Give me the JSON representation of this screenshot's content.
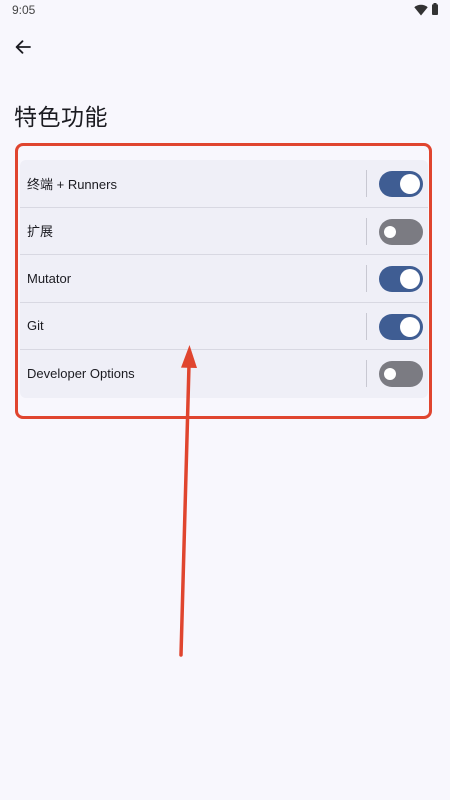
{
  "status_bar": {
    "time": "9:05",
    "icons": [
      "wifi-icon",
      "battery-icon"
    ]
  },
  "header": {
    "back_icon": "arrow-left-icon",
    "title": "特色功能"
  },
  "settings": {
    "items": [
      {
        "label": "终端 + Runners",
        "enabled": true
      },
      {
        "label": "扩展",
        "enabled": false
      },
      {
        "label": "Mutator",
        "enabled": true
      },
      {
        "label": "Git",
        "enabled": true
      },
      {
        "label": "Developer Options",
        "enabled": false
      }
    ]
  },
  "colors": {
    "background": "#f8f7fd",
    "list_background": "#efeff7",
    "toggle_on": "#3f5d93",
    "toggle_off": "#7b7b82",
    "annotation": "#e0452f"
  }
}
